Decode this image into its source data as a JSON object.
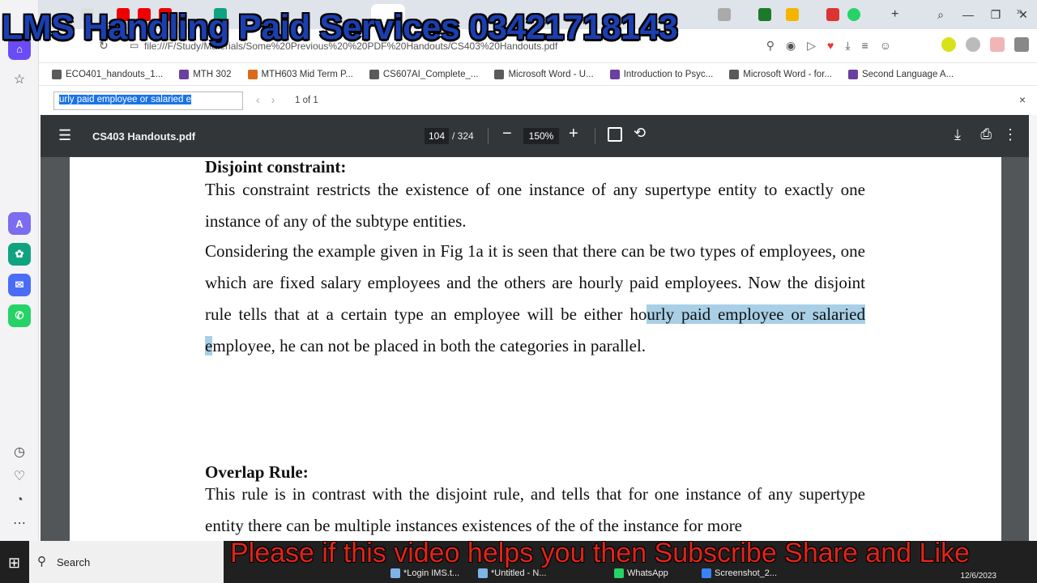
{
  "overlays": {
    "top_banner": "LMS Handling Paid Services 03421718143",
    "bottom_banner": "Please if this video helps you then Subscribe Share and Like"
  },
  "browser": {
    "url": "file:///F/Study/Materials/Some%20Previous%20%20PDF%20Handouts/CS403%20Handouts.pdf",
    "bookmarks": [
      {
        "label": "ECO401_handouts_1...",
        "color": "#5a5a5a"
      },
      {
        "label": "MTH 302",
        "color": "#6a3fa0"
      },
      {
        "label": "MTH603 Mid Term P...",
        "color": "#d96b1f"
      },
      {
        "label": "CS607AI_Complete_...",
        "color": "#5a5a5a"
      },
      {
        "label": "Microsoft Word - U...",
        "color": "#5a5a5a"
      },
      {
        "label": "Introduction to Psyc...",
        "color": "#6a3fa0"
      },
      {
        "label": "Microsoft Word - for...",
        "color": "#5a5a5a"
      },
      {
        "label": "Second Language A...",
        "color": "#6a3fa0"
      }
    ],
    "more_bookmarks": "»"
  },
  "findbar": {
    "query": "urly paid employee or salaried e",
    "count": "1 of 1",
    "close": "×"
  },
  "pdf": {
    "title": "CS403 Handouts.pdf",
    "page_current": "104",
    "page_total": "/ 324",
    "zoom": "150%",
    "heading1": "Disjoint constraint:",
    "para1": "This constraint restricts the existence of one instance of any supertype entity to exactly one instance of any of the subtype entities.",
    "para2_pre": "Considering the example given in Fig 1a it is seen that there can be two types of employees, one which are fixed salary employees and the others are hourly paid employees. Now the disjoint rule tells that at a certain type an employee will be either ho",
    "para2_mark": "urly paid employee or salaried e",
    "para2_post": "mployee, he can not be placed in both the categories in parallel.",
    "heading2": "Overlap Rule:",
    "para3": "This rule is in contrast with the disjoint rule, and tells that for one instance of any supertype entity there can be multiple instances existences of the of the instance for more"
  },
  "taskbar": {
    "search_label": "Search",
    "apps": [
      {
        "label": "*Login IMS.t...",
        "color": "#7fb3e6"
      },
      {
        "label": "*Untitled - N...",
        "color": "#7fb3e6"
      },
      {
        "label": "WhatsApp",
        "color": "#25d366"
      },
      {
        "label": "Screenshot_2...",
        "color": "#3b82f6"
      }
    ],
    "date": "12/6/2023"
  }
}
